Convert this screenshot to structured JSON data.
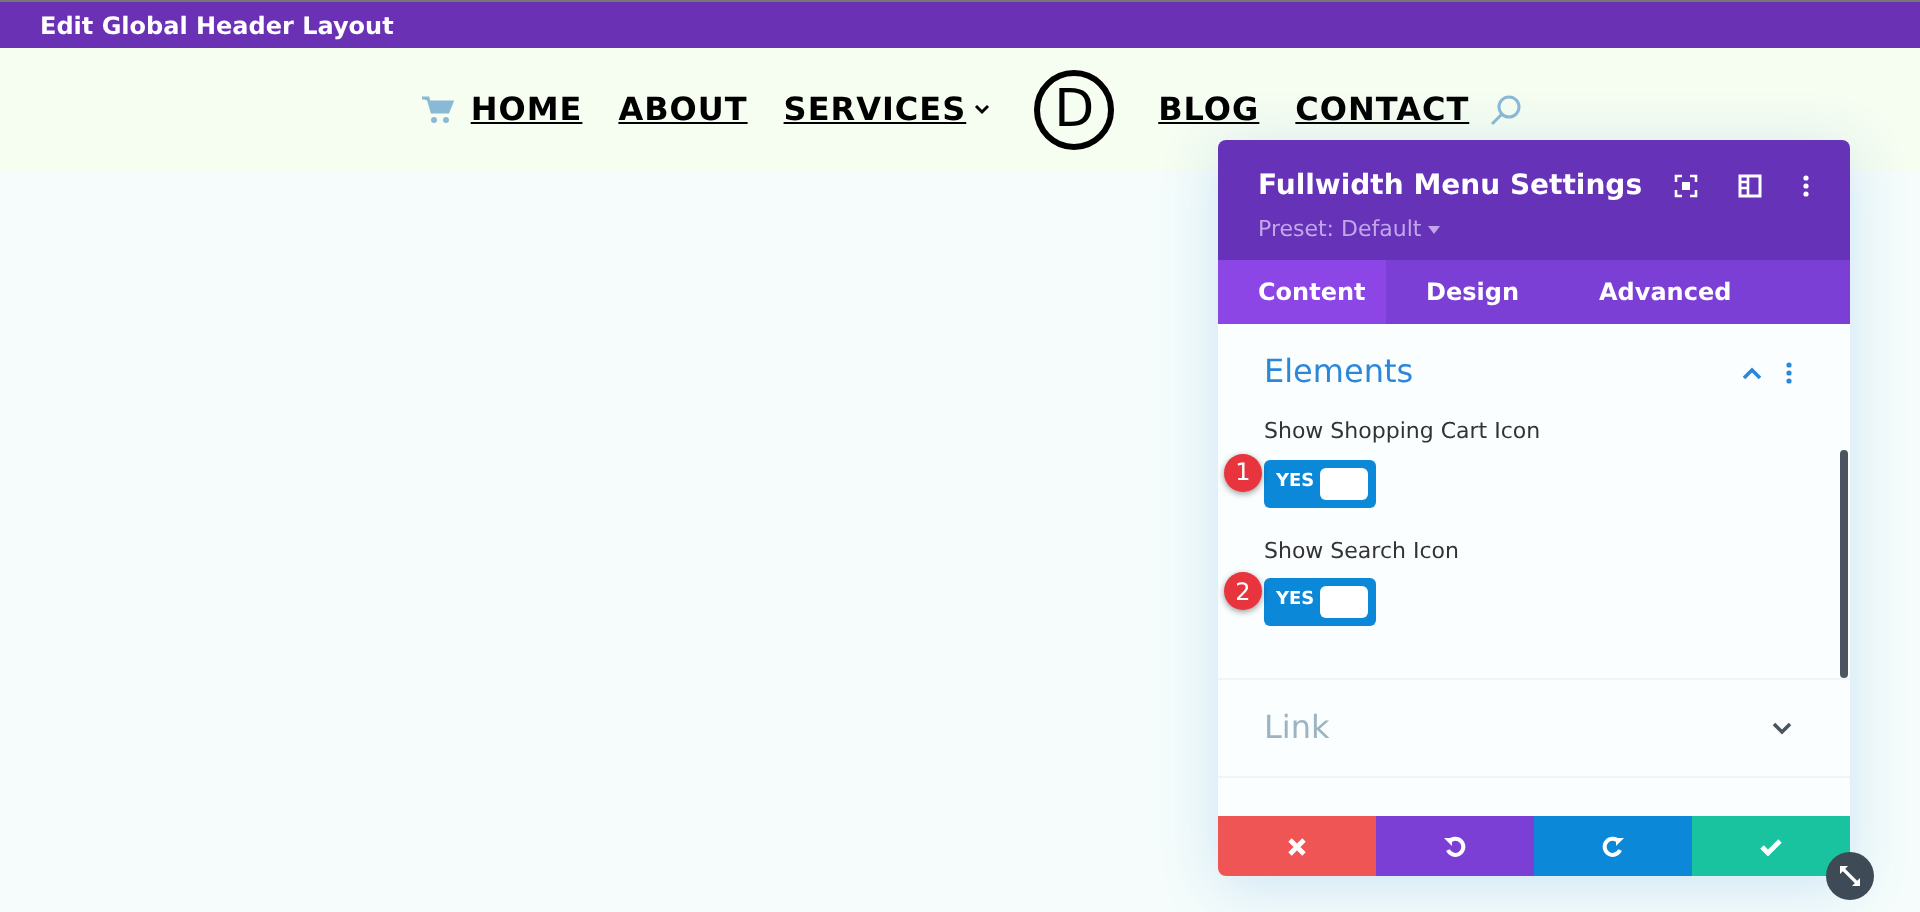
{
  "top_bar": {
    "title": "Edit Global Header Layout"
  },
  "nav": {
    "items": [
      {
        "label": "HOME",
        "dropdown": false
      },
      {
        "label": "ABOUT",
        "dropdown": false
      },
      {
        "label": "SERVICES",
        "dropdown": true
      },
      {
        "kind": "logo",
        "label": "D"
      },
      {
        "label": "BLOG",
        "dropdown": false
      },
      {
        "label": "CONTACT",
        "dropdown": false
      }
    ]
  },
  "panel": {
    "title": "Fullwidth Menu Settings",
    "preset": "Preset: Default",
    "tabs": [
      {
        "label": "Content",
        "selected": true
      },
      {
        "label": "Design",
        "selected": false
      },
      {
        "label": "Advanced",
        "selected": false
      }
    ],
    "sections": [
      {
        "title": "Elements",
        "expanded": true,
        "fields": [
          {
            "label": "Show Shopping Cart Icon",
            "toggle": "YES",
            "on": true,
            "badge": "1"
          },
          {
            "label": "Show Search Icon",
            "toggle": "YES",
            "on": true,
            "badge": "2"
          }
        ]
      },
      {
        "title": "Link",
        "expanded": false
      }
    ]
  }
}
